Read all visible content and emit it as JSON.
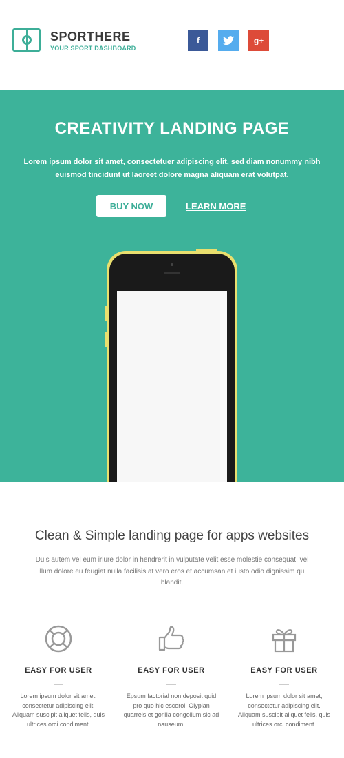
{
  "header": {
    "brand_bold": "SPORT",
    "brand_light": "HERE",
    "tagline": "YOUR SPORT DASHBOARD",
    "social": [
      {
        "label": "f",
        "icon": "facebook-icon",
        "color": "#3b5998"
      },
      {
        "label": "t",
        "icon": "twitter-icon",
        "color": "#55acee"
      },
      {
        "label": "g+",
        "icon": "google-plus-icon",
        "color": "#dd4b39"
      }
    ]
  },
  "hero": {
    "title": "CREATIVITY LANDING PAGE",
    "text": "Lorem ipsum dolor sit amet, consectetuer adipiscing elit, sed diam nonummy nibh euismod tincidunt ut laoreet dolore magna aliquam erat volutpat.",
    "buy_label": "BUY NOW",
    "learn_label": "LEARN MORE",
    "bg_color": "#3db39a"
  },
  "content": {
    "title": "Clean & Simple landing page for apps websites",
    "text": "Duis autem vel eum iriure dolor in hendrerit in vulputate velit esse molestie consequat, vel illum dolore eu feugiat nulla facilisis at vero eros et accumsan et iusto odio dignissim qui blandit."
  },
  "features": [
    {
      "icon": "lifebuoy-icon",
      "title": "EASY FOR USER",
      "text": "Lorem ipsum dolor sit amet, consectetur adipiscing elit. Aliquam suscipit aliquet felis, quis ultrices orci condiment."
    },
    {
      "icon": "thumbs-up-icon",
      "title": "EASY FOR USER",
      "text": "Epsum factorial non deposit quid pro quo hic escorol. Olypian quarrels et gorilla congolium sic ad nauseum."
    },
    {
      "icon": "gift-icon",
      "title": "EASY FOR USER",
      "text": "Lorem ipsum dolor sit amet, consectetur adipiscing elit. Aliquam suscipit aliquet felis, quis ultrices orci condiment."
    }
  ]
}
